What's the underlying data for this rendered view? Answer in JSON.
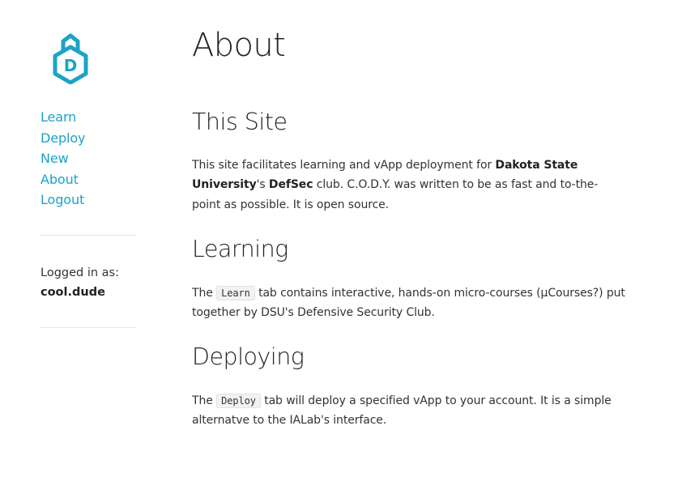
{
  "sidebar": {
    "logo_letter": "D",
    "nav": [
      {
        "label": "Learn"
      },
      {
        "label": "Deploy"
      },
      {
        "label": "New"
      },
      {
        "label": "About"
      },
      {
        "label": "Logout"
      }
    ],
    "logged_in_label": "Logged in as:",
    "username": "cool.dude"
  },
  "main": {
    "title": "About",
    "sections": [
      {
        "heading": "This Site",
        "t1": "This site facilitates learning and vApp deployment for ",
        "b1": "Dakota State University",
        "t2": "'s ",
        "b2": "DefSec",
        "t3": " club. C.O.D.Y. was written to be as fast and to-the-point as possible. It is open source."
      },
      {
        "heading": "Learning",
        "t1": "The ",
        "code": "Learn",
        "t2": " tab contains interactive, hands-on micro-courses (µCourses?) put together by DSU's Defensive Security Club."
      },
      {
        "heading": "Deploying",
        "t1": "The ",
        "code": "Deploy",
        "t2": " tab will deploy a specified vApp to your account. It is a simple alternatve to the IALab's interface."
      }
    ]
  },
  "colors": {
    "accent": "#1ba3c9",
    "text": "#333333",
    "divider": "#e5e5e5"
  }
}
